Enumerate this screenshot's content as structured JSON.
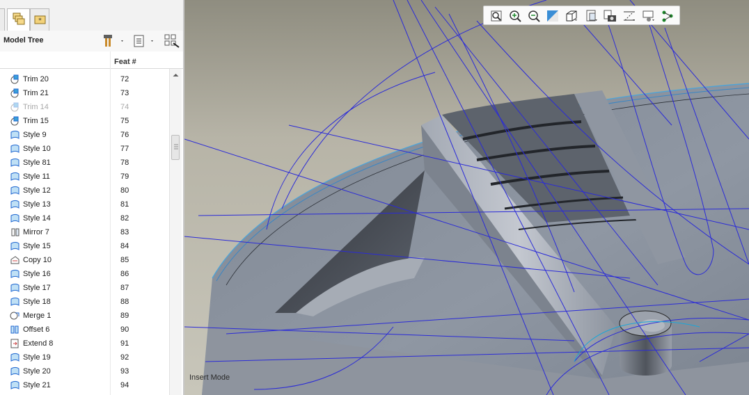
{
  "model_tree": {
    "title": "Model Tree",
    "column_feat": "Feat #",
    "rows": [
      {
        "name": "Trim 20",
        "feat": "72",
        "icon": "trim-icon"
      },
      {
        "name": "Trim 21",
        "feat": "73",
        "icon": "trim-icon"
      },
      {
        "name": "Trim 14",
        "feat": "74",
        "icon": "trim-icon",
        "suppressed": true
      },
      {
        "name": "Trim 15",
        "feat": "75",
        "icon": "trim-icon"
      },
      {
        "name": "Style 9",
        "feat": "76",
        "icon": "style-icon"
      },
      {
        "name": "Style 10",
        "feat": "77",
        "icon": "style-icon"
      },
      {
        "name": "Style 81",
        "feat": "78",
        "icon": "style-icon"
      },
      {
        "name": "Style 11",
        "feat": "79",
        "icon": "style-icon"
      },
      {
        "name": "Style 12",
        "feat": "80",
        "icon": "style-icon"
      },
      {
        "name": "Style 13",
        "feat": "81",
        "icon": "style-icon"
      },
      {
        "name": "Style 14",
        "feat": "82",
        "icon": "style-icon"
      },
      {
        "name": "Mirror 7",
        "feat": "83",
        "icon": "mirror-icon"
      },
      {
        "name": "Style 15",
        "feat": "84",
        "icon": "style-icon"
      },
      {
        "name": "Copy 10",
        "feat": "85",
        "icon": "copy-icon"
      },
      {
        "name": "Style 16",
        "feat": "86",
        "icon": "style-icon"
      },
      {
        "name": "Style 17",
        "feat": "87",
        "icon": "style-icon"
      },
      {
        "name": "Style 18",
        "feat": "88",
        "icon": "style-icon"
      },
      {
        "name": "Merge 1",
        "feat": "89",
        "icon": "merge-icon"
      },
      {
        "name": "Offset 6",
        "feat": "90",
        "icon": "offset-icon"
      },
      {
        "name": "Extend 8",
        "feat": "91",
        "icon": "extend-icon"
      },
      {
        "name": "Style 19",
        "feat": "92",
        "icon": "style-icon"
      },
      {
        "name": "Style 20",
        "feat": "93",
        "icon": "style-icon"
      },
      {
        "name": "Style 21",
        "feat": "94",
        "icon": "style-icon"
      }
    ]
  },
  "viewport": {
    "status_text": "Insert Mode",
    "toolbar_icons": [
      "refit-icon",
      "zoom-in-icon",
      "zoom-out-icon",
      "repaint-icon",
      "display-style-icon",
      "saved-views-icon",
      "view-manager-icon",
      "datum-display-icon",
      "spin-center-icon",
      "annotation-display-icon"
    ]
  },
  "colors": {
    "accent_blue": "#1e66d0",
    "curve_blue": "#2a2ad8",
    "model_gray": "#8a919b"
  }
}
